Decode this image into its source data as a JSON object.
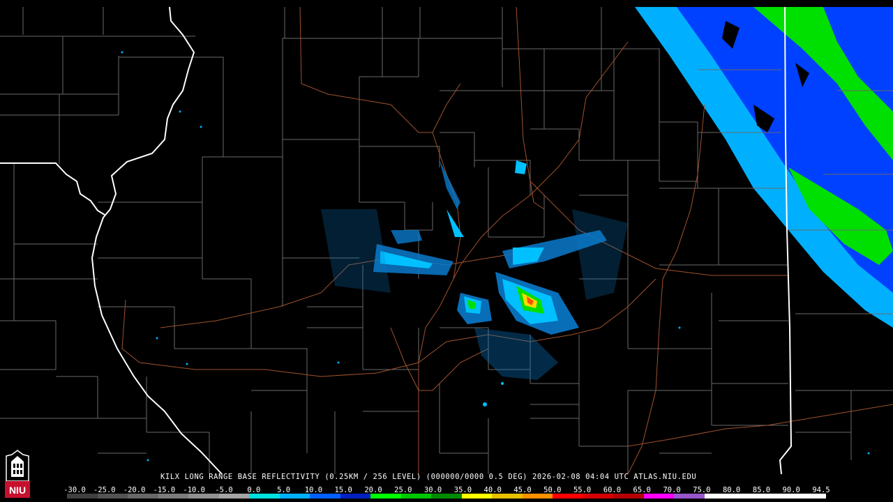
{
  "caption": "KILX LONG RANGE BASE REFLECTIVITY (0.25KM / 256 LEVEL) (000000/0000 0.5 DEG) 2026-02-08 04:04 UTC  ATLAS.NIU.EDU",
  "logo_text": "NIU",
  "colors": {
    "background": "#000000",
    "county_lines": "#6a6a6a",
    "state_lines": "#ffffff",
    "roads": "#a0522d"
  },
  "scale": {
    "labels": [
      "-30.0",
      "-25.0",
      "-20.0",
      "-15.0",
      "-10.0",
      "-5.0",
      "0.0",
      "5.0",
      "10.0",
      "15.0",
      "20.0",
      "25.0",
      "30.0",
      "35.0",
      "40.0",
      "45.0",
      "50.0",
      "55.0",
      "60.0",
      "65.0",
      "70.0",
      "75.0",
      "80.0",
      "85.0",
      "90.0",
      "94.5"
    ],
    "segment_colors": [
      "#404040",
      "#545454",
      "#686868",
      "#7c7c7c",
      "#909090",
      "#a4a4a4",
      "#00e0e0",
      "#00b0ff",
      "#0060ff",
      "#0020c0",
      "#00ff00",
      "#00c800",
      "#008c00",
      "#ffff00",
      "#e8c000",
      "#ff9000",
      "#ff0000",
      "#d40000",
      "#b40000",
      "#ff00ff",
      "#9955cc",
      "#ffffff",
      "#ffffff",
      "#ffffff",
      "#ffffff"
    ]
  }
}
